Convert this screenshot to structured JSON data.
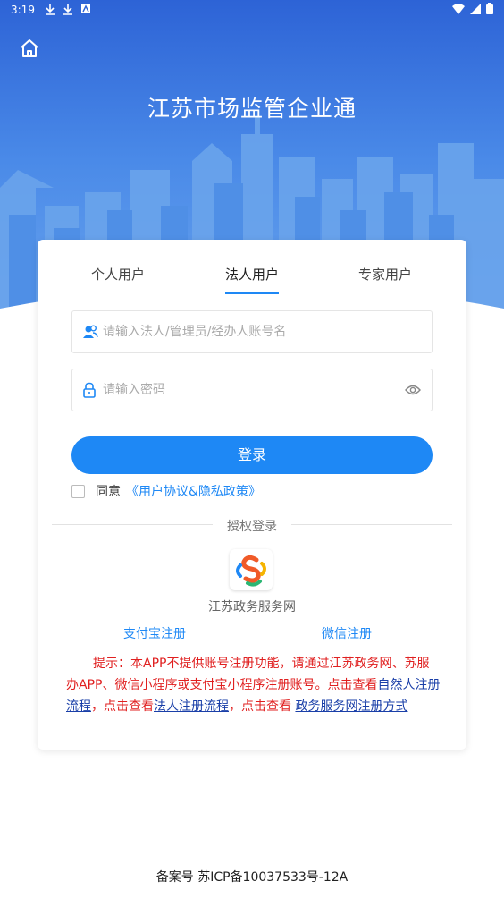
{
  "status_bar": {
    "time": "3:19",
    "left_icons": [
      "download-icon",
      "download-icon",
      "app-notification-icon"
    ],
    "right_icons": [
      "wifi-icon",
      "signal-icon",
      "battery-icon"
    ]
  },
  "header": {
    "home_icon": "home-icon",
    "title": "江苏市场监管企业通"
  },
  "tabs": [
    {
      "label": "个人用户",
      "active": false
    },
    {
      "label": "法人用户",
      "active": true
    },
    {
      "label": "专家用户",
      "active": false
    }
  ],
  "form": {
    "account_placeholder": "请输入法人/管理员/经办人账号名",
    "account_value": "",
    "password_placeholder": "请输入密码",
    "password_value": "",
    "login_label": "登录",
    "agree_label": "同意",
    "agree_link": "《用户协议&隐私政策》",
    "agree_checked": false
  },
  "auth": {
    "divider_label": "授权登录",
    "provider_name": "江苏政务服务网",
    "alipay_register": "支付宝注册",
    "wechat_register": "微信注册"
  },
  "notice": {
    "text_1": "提示：本APP不提供账号注册功能，请通过江苏政务网、苏服办APP、微信小程序或支付宝小程序注册账号。点击查看",
    "link_1": "自然人注册流程",
    "text_2": "，点击查看",
    "link_2": "法人注册流程",
    "text_3": "，点击查看 ",
    "link_3": "政务服务网注册方式"
  },
  "footer": {
    "icp": "备案号 苏ICP备10037533号-12A"
  },
  "colors": {
    "accent": "#1e88f5",
    "notice_red": "#e02020",
    "link_dark_blue": "#1a3fa8"
  }
}
